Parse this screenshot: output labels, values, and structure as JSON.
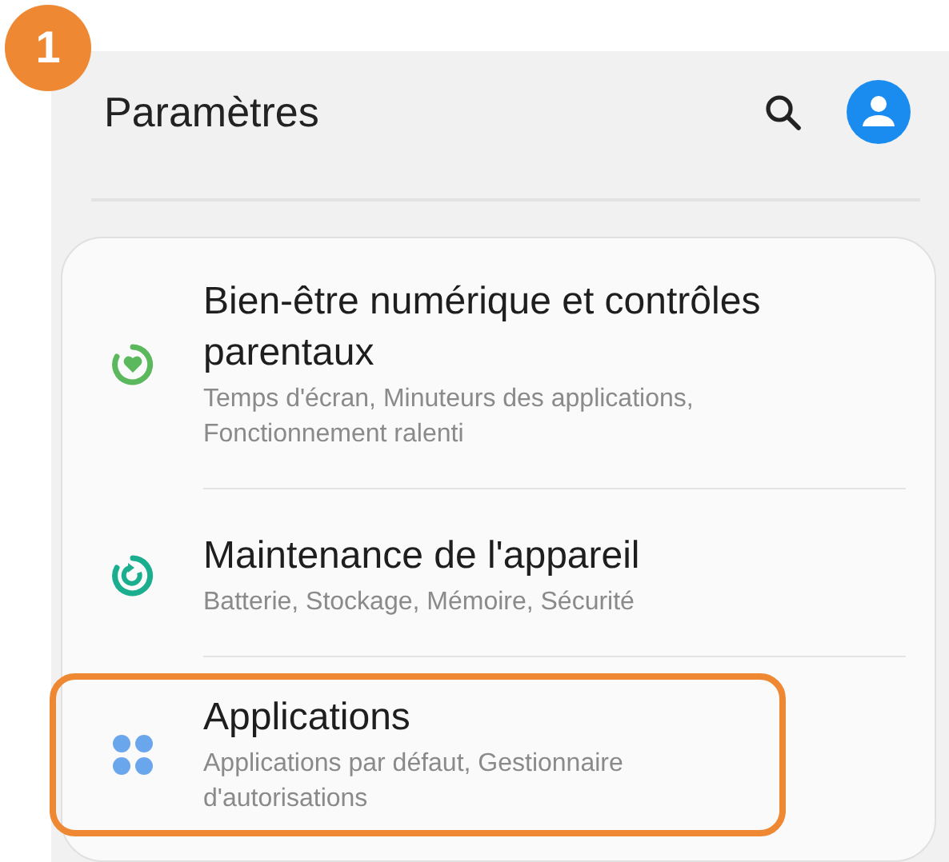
{
  "step_badge": "1",
  "header": {
    "title": "Paramètres"
  },
  "items": [
    {
      "kind": "wellbeing",
      "color": "#5cb85c",
      "title": "Bien-être numérique et contrôles parentaux",
      "subtitle": "Temps d'écran, Minuteurs des applications, Fonctionnement ralenti",
      "highlighted": false
    },
    {
      "kind": "maintenance",
      "color": "#1aae8f",
      "title": "Maintenance de l'appareil",
      "subtitle": "Batterie, Stockage, Mémoire, Sécurité",
      "highlighted": false
    },
    {
      "kind": "apps",
      "color": "#6aa6ec",
      "title": "Applications",
      "subtitle": "Applications par défaut, Gestionnaire d'autorisations",
      "highlighted": true
    }
  ]
}
